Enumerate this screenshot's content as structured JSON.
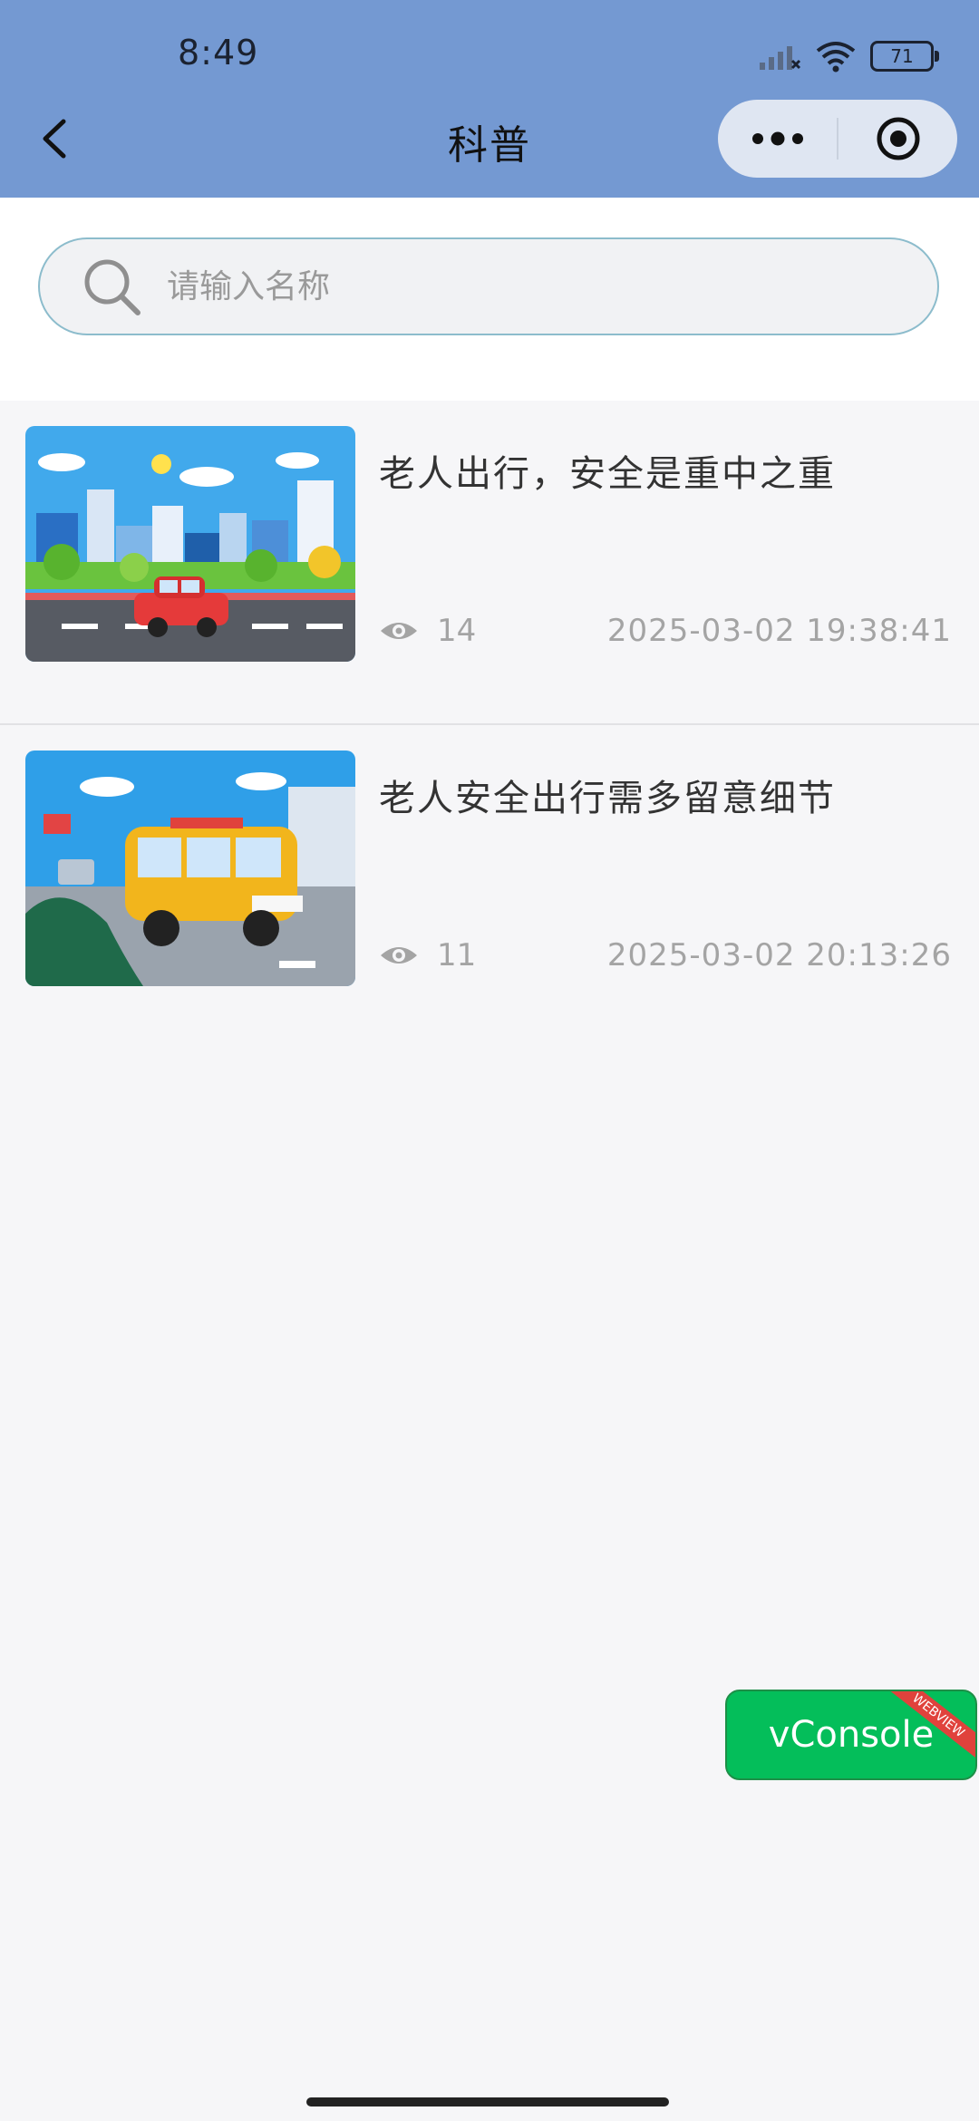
{
  "status_bar": {
    "time": "8:49",
    "battery": "71"
  },
  "nav": {
    "title": "科普"
  },
  "search": {
    "placeholder": "请输入名称"
  },
  "items": [
    {
      "title": "老人出行，安全是重中之重",
      "views": "14",
      "date": "2025-03-02 19:38:41"
    },
    {
      "title": "老人安全出行需多留意细节",
      "views": "11",
      "date": "2025-03-02 20:13:26"
    }
  ],
  "vconsole": {
    "label": "vConsole",
    "ribbon": "WEBVIEW"
  },
  "icons": [
    "back-icon",
    "more-icon",
    "target-icon",
    "search-icon",
    "eye-icon",
    "signal-icon",
    "wifi-icon",
    "battery-icon"
  ]
}
